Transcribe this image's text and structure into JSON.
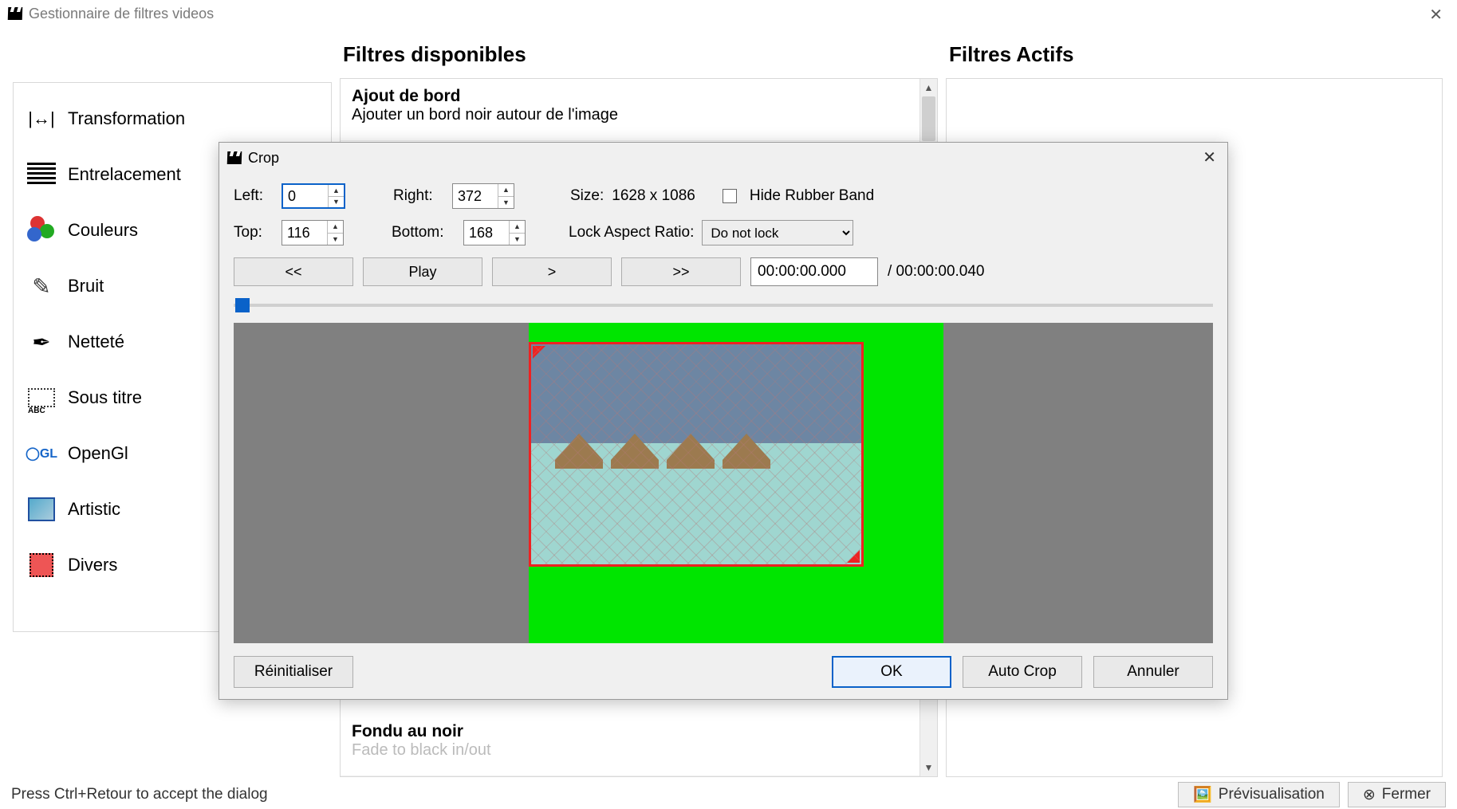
{
  "window": {
    "title": "Gestionnaire de filtres videos"
  },
  "headings": {
    "available": "Filtres disponibles",
    "active": "Filtres Actifs"
  },
  "categories": [
    {
      "label": "Transformation",
      "icon": "transform"
    },
    {
      "label": "Entrelacement",
      "icon": "interlace"
    },
    {
      "label": "Couleurs",
      "icon": "colors"
    },
    {
      "label": "Bruit",
      "icon": "noise"
    },
    {
      "label": "Netteté",
      "icon": "sharp"
    },
    {
      "label": "Sous titre",
      "icon": "sub"
    },
    {
      "label": "OpenGl",
      "icon": "opengl"
    },
    {
      "label": "Artistic",
      "icon": "art"
    },
    {
      "label": "Divers",
      "icon": "misc"
    }
  ],
  "filters_visible": {
    "top": {
      "name": "Ajout de bord",
      "desc": "Ajouter un bord noir autour de l'image"
    },
    "bottom": {
      "name": "Fondu au noir",
      "desc": "Fade to black in/out"
    }
  },
  "statusbar": {
    "hint": "Press Ctrl+Retour to accept the dialog",
    "preview": "Prévisualisation",
    "close": "Fermer"
  },
  "dialog": {
    "title": "Crop",
    "labels": {
      "left": "Left:",
      "right": "Right:",
      "top": "Top:",
      "bottom": "Bottom:",
      "size": "Size:",
      "hide_rb": "Hide Rubber Band",
      "lock_ar": "Lock Aspect Ratio:"
    },
    "values": {
      "left": "0",
      "right": "372",
      "top": "116",
      "bottom": "168",
      "size": "1628 x 1086",
      "lock_option": "Do not lock",
      "time_cur": "00:00:00.000",
      "time_total": "/ 00:00:00.040"
    },
    "transport": {
      "rev": "<<",
      "play": "Play",
      "fwd1": ">",
      "fwd2": ">>"
    },
    "buttons": {
      "reset": "Réinitialiser",
      "ok": "OK",
      "autocrop": "Auto Crop",
      "cancel": "Annuler"
    }
  }
}
